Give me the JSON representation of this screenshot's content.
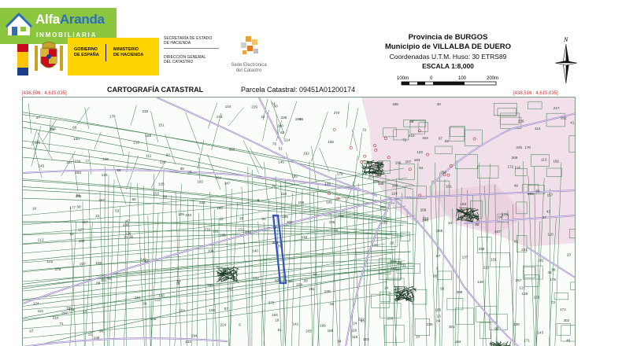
{
  "logo": {
    "name_a": "Alfa",
    "name_b": "Aranda",
    "tagline": "INMOBILIARIA"
  },
  "gov": {
    "line1": "GOBIERNO",
    "line2": "DE ESPAÑA",
    "line3": "MINISTERIO",
    "line4": "DE HACIENDA"
  },
  "ministry": {
    "sec_line1": "SECRETARÍA DE ESTADO",
    "sec_line2": "DE HACIENDA",
    "dir_line1": "DIRECCIÓN GENERAL",
    "dir_line2": "DEL CATASTRO"
  },
  "sede": {
    "line1": "Sede Electrónica",
    "line2": "del Catastro"
  },
  "header": {
    "province": "Provincia de BURGOS",
    "municipality": "Municipio de VILLALBA DE DUERO",
    "coords": "Coordenadas U.T.M. Huso: 30 ETRS89",
    "scale": "ESCALA 1:8,000"
  },
  "scale_ticks": [
    "100m",
    "0",
    "100",
    "200m"
  ],
  "north_label": "N",
  "title_carto": "CARTOGRAFÍA CATASTRAL",
  "parcel": "Parcela Catastral: 09451A01200174",
  "coord_left": "[436,596 ; 4,615,035]",
  "coord_right": "[438,516 ; 4,615,035]",
  "map": {
    "colors": {
      "rural": "#3d7a4e",
      "urban": "#e9c6da",
      "road": "#9b86c6",
      "parcel": "#3a50c8"
    },
    "labels": [
      "76",
      "17",
      "27",
      "19",
      "77",
      "78",
      "79",
      "80",
      "82",
      "101",
      "44",
      "98",
      "95",
      "64",
      "14",
      "10",
      "12",
      "13",
      "18",
      "1",
      "8",
      "43",
      "92",
      "48",
      "49",
      "50",
      "54",
      "53",
      "61",
      "67",
      "68",
      "66",
      "21",
      "20",
      "113",
      "114",
      "152",
      "157",
      "156",
      "158",
      "159",
      "162",
      "104",
      "102",
      "103",
      "111",
      "112",
      "129",
      "130",
      "135",
      "144",
      "143",
      "142",
      "147",
      "148",
      "149",
      "151",
      "110",
      "106",
      "108",
      "184",
      "183",
      "182",
      "181",
      "180",
      "169",
      "185",
      "187",
      "188",
      "189",
      "191",
      "194",
      "196",
      "197",
      "198",
      "200",
      "210",
      "213",
      "212",
      "214",
      "225",
      "230",
      "232",
      "233",
      "234",
      "235",
      "236",
      "239",
      "240",
      "243",
      "245",
      "250",
      "258",
      "259",
      "261",
      "263",
      "264",
      "267",
      "270",
      "272",
      "276",
      "281",
      "283",
      "294",
      "296",
      "301",
      "302",
      "305",
      "308",
      "372",
      "62",
      "51",
      "41",
      "23",
      "22",
      "46",
      "93",
      "15",
      "16",
      "30",
      "40",
      "31",
      "10",
      "5",
      "171",
      "172",
      "173",
      "174",
      "178",
      "175",
      "176",
      "177",
      "179",
      "84",
      "85",
      "86",
      "89",
      "90",
      "91",
      "24",
      "25",
      "26",
      "28",
      "32",
      "34",
      "36",
      "37",
      "38",
      "39",
      "42",
      "45",
      "47",
      "52",
      "55",
      "56",
      "57",
      "58",
      "59",
      "60",
      "63",
      "65",
      "69",
      "70",
      "71",
      "72",
      "73",
      "74",
      "75",
      "81",
      "83",
      "87",
      "88",
      "94",
      "96",
      "97",
      "99",
      "100",
      "105",
      "107",
      "109",
      "115",
      "116",
      "117",
      "118",
      "119",
      "120",
      "121",
      "122",
      "123",
      "124",
      "125",
      "126",
      "127",
      "128",
      "131",
      "132",
      "133",
      "134",
      "136",
      "137",
      "138",
      "139",
      "140",
      "141",
      "145",
      "146",
      "150",
      "153",
      "154",
      "155",
      "160",
      "161",
      "163",
      "164",
      "165",
      "166",
      "167",
      "168",
      "170",
      "186",
      "190",
      "192",
      "193",
      "195",
      "199",
      "201",
      "202",
      "203",
      "204",
      "205",
      "206",
      "207",
      "208",
      "209",
      "211",
      "215",
      "216",
      "217",
      "218",
      "219",
      "220",
      "221",
      "222",
      "223",
      "224",
      "226",
      "227",
      "228",
      "229",
      "231",
      "237",
      "238",
      "241",
      "242",
      "244",
      "246",
      "247",
      "248",
      "249"
    ]
  }
}
